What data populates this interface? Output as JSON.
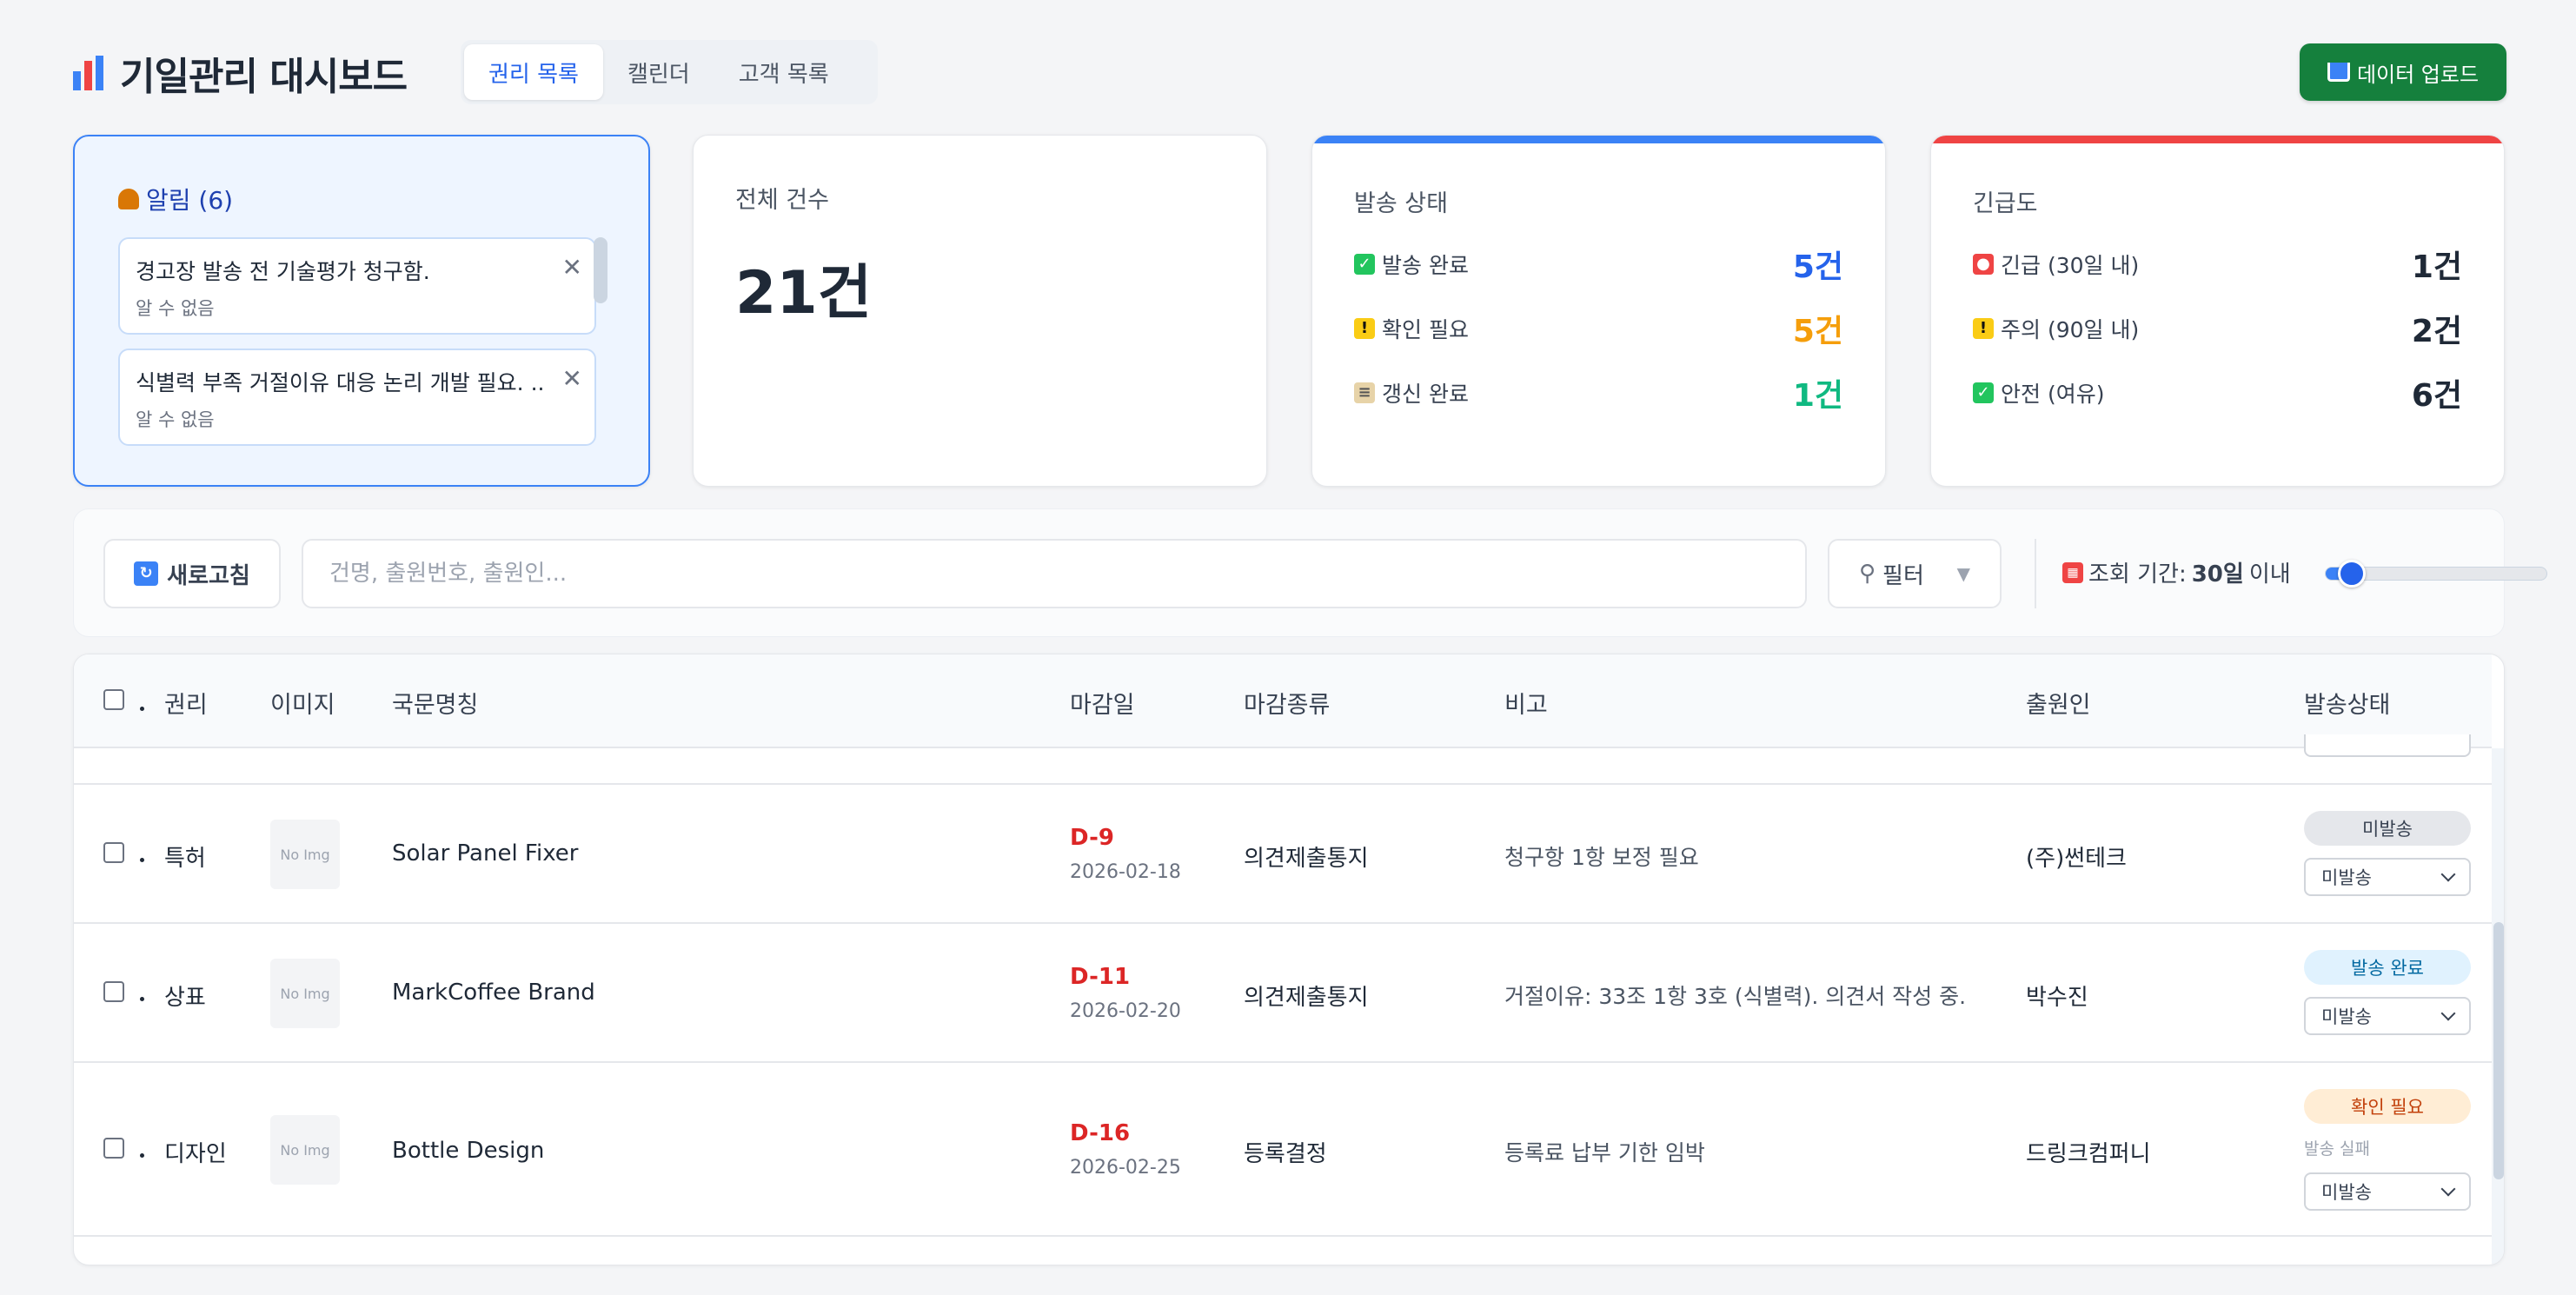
{
  "header": {
    "title": "기일관리 대시보드",
    "tabs": [
      {
        "label": "권리 목록",
        "active": true
      },
      {
        "label": "캘린더",
        "active": false
      },
      {
        "label": "고객 목록",
        "active": false
      }
    ],
    "upload_label": "데이터 업로드"
  },
  "alerts": {
    "title": "알림 (6)",
    "items": [
      {
        "text": "경고장 발송 전 기술평가 청구함.",
        "sub": "알 수 없음"
      },
      {
        "text": "식별력 부족 거절이유 대응 논리 개발 필요. ...",
        "sub": "알 수 없음"
      }
    ]
  },
  "total": {
    "label": "전체 건수",
    "value": "21건"
  },
  "send_status": {
    "label": "발송 상태",
    "accent": "#3b82f6",
    "rows": [
      {
        "icon": "check-icon",
        "label": "발송 완료",
        "value": "5건",
        "color": "#2563eb"
      },
      {
        "icon": "warning-icon",
        "label": "확인 필요",
        "value": "5건",
        "color": "#f59e0b"
      },
      {
        "icon": "ledger-icon",
        "label": "갱신 완료",
        "value": "1건",
        "color": "#10b981"
      }
    ]
  },
  "urgency": {
    "label": "긴급도",
    "accent": "#ef4444",
    "rows": [
      {
        "icon": "siren-icon",
        "label": "긴급 (30일 내)",
        "value": "1건"
      },
      {
        "icon": "warning-icon",
        "label": "주의 (90일 내)",
        "value": "2건"
      },
      {
        "icon": "check-icon",
        "label": "안전 (여유)",
        "value": "6건"
      }
    ]
  },
  "toolbar": {
    "refresh_label": "새로고침",
    "search_placeholder": "건명, 출원번호, 출원인...",
    "filter_label": "필터",
    "period_prefix": "조회 기간:",
    "period_value": "30일",
    "period_suffix": "이내",
    "slider_fraction": 0.08
  },
  "table": {
    "columns": [
      "권리",
      "이미지",
      "국문명칭",
      "마감일",
      "마감종류",
      "비고",
      "출원인",
      "발송상태"
    ],
    "rows": [
      {
        "right": "특허",
        "image": "No Img",
        "name": "Solar Panel Fixer",
        "dday": "D-9",
        "date": "2026-02-18",
        "type": "의견제출통지",
        "note": "청구항 1항 보정 필요",
        "applicant": "(주)썬테크",
        "badge": "미발송",
        "badge_bg": "#e5e7eb",
        "badge_fg": "#374151",
        "select": "미발송",
        "fail": ""
      },
      {
        "right": "상표",
        "image": "No Img",
        "name": "MarkCoffee Brand",
        "dday": "D-11",
        "date": "2026-02-20",
        "type": "의견제출통지",
        "note": "거절이유: 33조 1항 3호 (식별력). 의견서 작성 중.",
        "applicant": "박수진",
        "badge": "발송 완료",
        "badge_bg": "#e0f2fe",
        "badge_fg": "#0369a1",
        "select": "미발송",
        "fail": ""
      },
      {
        "right": "디자인",
        "image": "No Img",
        "name": "Bottle Design",
        "dday": "D-16",
        "date": "2026-02-25",
        "type": "등록결정",
        "note": "등록료 납부 기한 임박",
        "applicant": "드링크컴퍼니",
        "badge": "확인 필요",
        "badge_bg": "#ffedd5",
        "badge_fg": "#c2410c",
        "select": "미발송",
        "fail": "발송 실패"
      }
    ]
  }
}
